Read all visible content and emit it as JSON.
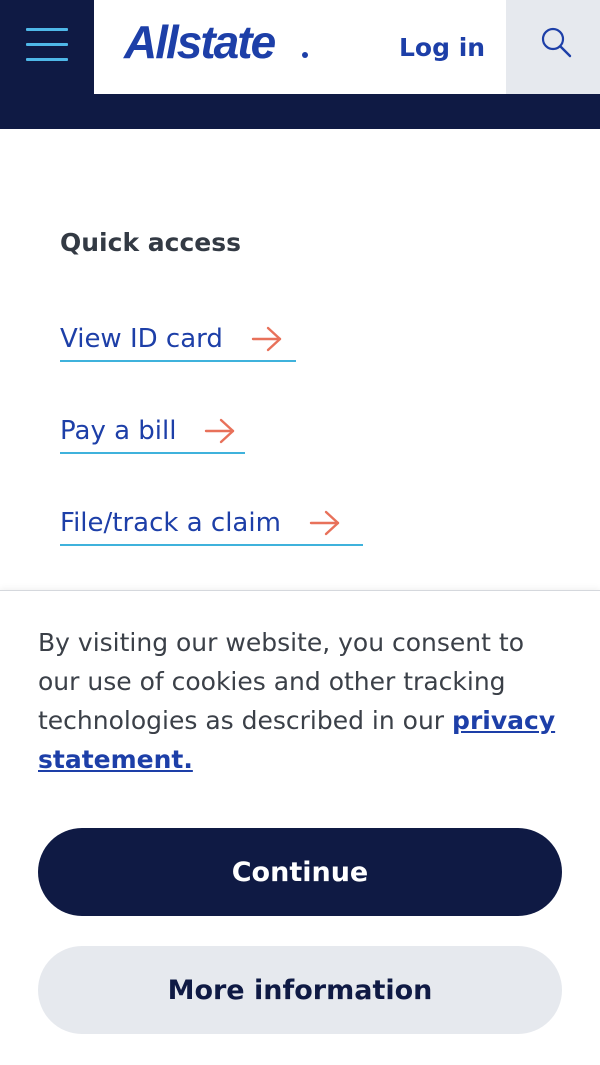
{
  "header": {
    "menu_icon": "hamburger-menu-icon",
    "logo_text": "Allstate",
    "login_label": "Log in",
    "search_icon": "search-icon",
    "colors": {
      "navy": "#0f1a44",
      "brand_blue": "#1d3fa8",
      "menu_accent": "#4fb8e8"
    }
  },
  "quick_access": {
    "title": "Quick access",
    "links": [
      {
        "label": "View ID card",
        "icon": "arrow-right-icon"
      },
      {
        "label": "Pay a bill",
        "icon": "arrow-right-icon"
      },
      {
        "label": "File/track a claim",
        "icon": "arrow-right-icon"
      }
    ],
    "colors": {
      "link": "#1d3fa8",
      "arrow": "#e8715a",
      "underline": "#3fb2dc"
    }
  },
  "cookie_banner": {
    "text": "By visiting our website, you consent to our use of cookies and other tracking technologies as described in our",
    "link_label": "privacy statement.",
    "continue_label": "Continue",
    "more_info_label": "More information"
  }
}
